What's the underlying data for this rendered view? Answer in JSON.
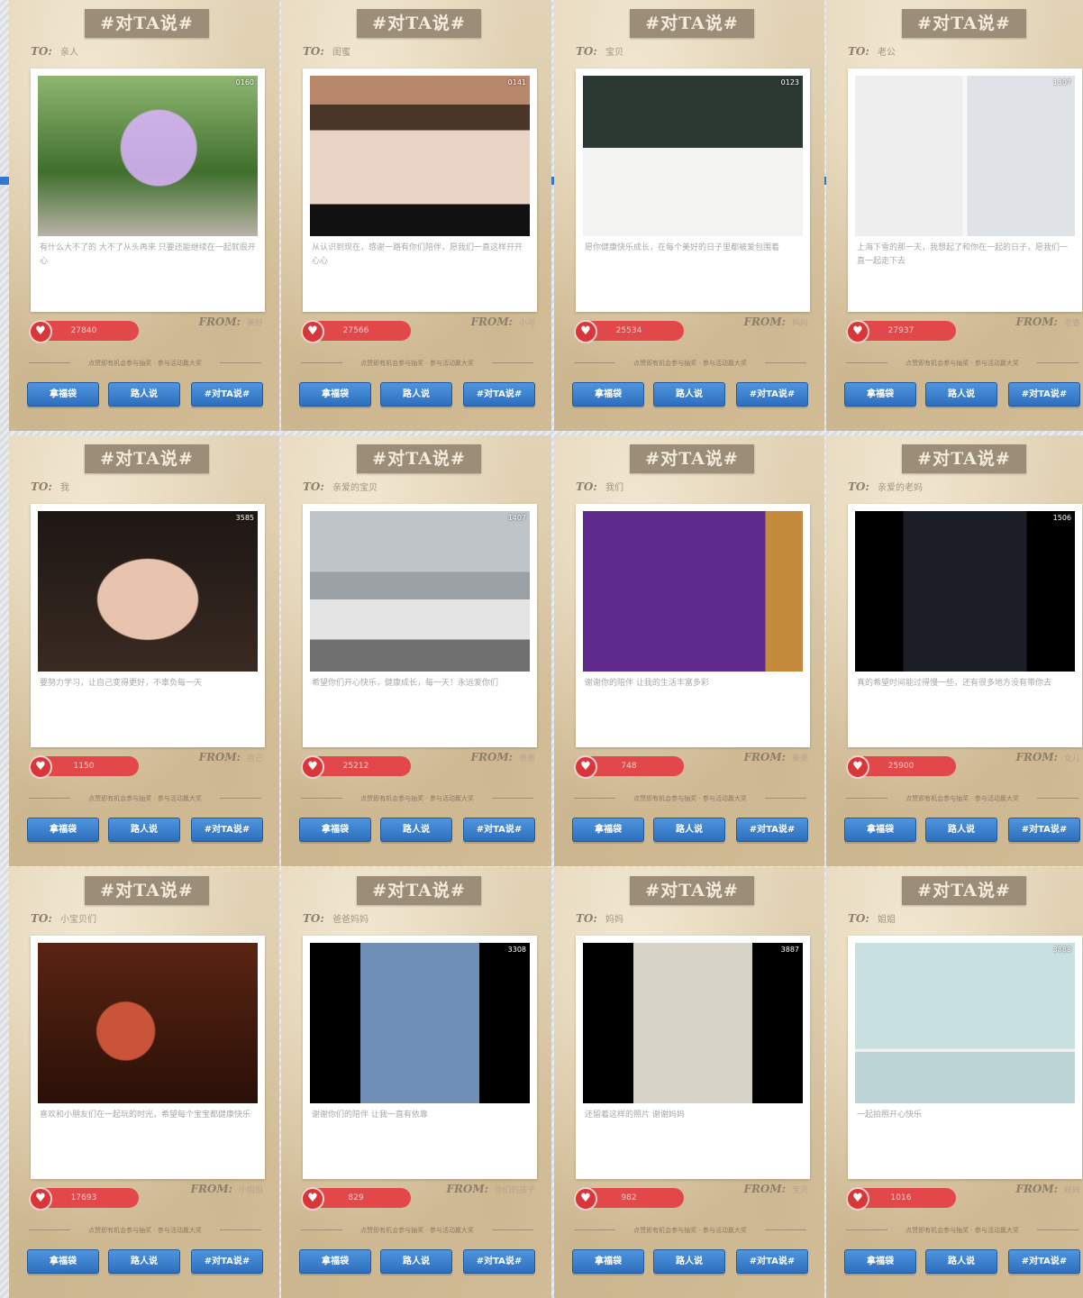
{
  "ui": {
    "banner_title": "#对TA说#",
    "to_label": "TO:",
    "from_label": "FROM:",
    "divider_caption": "点赞即有机会参与抽奖 · 参与活动赢大奖",
    "heart_glyph": "♥",
    "buttons": [
      "拿福袋",
      "路人说",
      "#对TA说#"
    ],
    "colors": {
      "button": "#2e6fbd",
      "like": "#e2484a",
      "banner": "#9b8d78"
    }
  },
  "cards": [
    {
      "to": "亲人",
      "counter": "0160",
      "message": "有什么大不了的 大不了从头再来 只要还能继续在一起就很开心",
      "likes": "27840",
      "from": "美好"
    },
    {
      "to": "闺蜜",
      "counter": "0141",
      "message": "从认识到现在，感谢一路有你们陪伴，愿我们一直这样开开心心",
      "likes": "27566",
      "from": "小可"
    },
    {
      "to": "宝贝",
      "counter": "0123",
      "message": "愿你健康快乐成长，在每个美好的日子里都被爱包围着",
      "likes": "25534",
      "from": "妈妈"
    },
    {
      "to": "老公",
      "counter": "1307",
      "message": "上海下雪的那一天，我想起了和你在一起的日子，愿我们一直一起走下去",
      "likes": "27937",
      "from": "老婆"
    },
    {
      "to": "我",
      "counter": "3585",
      "message": "要努力学习，让自己变得更好，不辜负每一天",
      "likes": "1150",
      "from": "自己"
    },
    {
      "to": "亲爱的宝贝",
      "counter": "1407",
      "message": "希望你们开心快乐，健康成长，每一天！永远爱你们",
      "likes": "25212",
      "from": "爸爸"
    },
    {
      "to": "我们",
      "counter": "",
      "message": "谢谢你的陪伴 让我的生活丰富多彩",
      "likes": "748",
      "from": "美美"
    },
    {
      "to": "亲爱的老妈",
      "counter": "1506",
      "message": "真的希望时间能过得慢一些，还有很多地方没有带你去",
      "likes": "25900",
      "from": "女儿"
    },
    {
      "to": "小宝贝们",
      "counter": "",
      "message": "喜欢和小朋友们在一起玩的时光，希望每个宝宝都健康快乐",
      "likes": "17693",
      "from": "小姐姐"
    },
    {
      "to": "爸爸妈妈",
      "counter": "3308",
      "message": "谢谢你们的陪伴 让我一直有依靠",
      "likes": "829",
      "from": "你们的孩子"
    },
    {
      "to": "妈妈",
      "counter": "3887",
      "message": "还留着这样的照片 谢谢妈妈",
      "likes": "982",
      "from": "宝贝"
    },
    {
      "to": "姐姐",
      "counter": "3888",
      "message": "一起拍照开心快乐",
      "likes": "1016",
      "from": "妹妹"
    }
  ]
}
